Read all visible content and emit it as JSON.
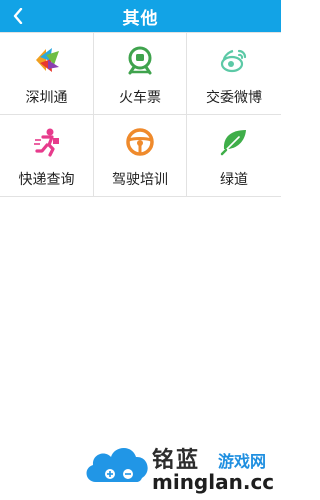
{
  "header": {
    "title": "其他",
    "back_icon": "chevron-left-icon"
  },
  "colors": {
    "accent": "#12a3e6"
  },
  "grid": [
    {
      "label": "深圳通",
      "icon": "shenzhentong-icon"
    },
    {
      "label": "火车票",
      "icon": "train-icon"
    },
    {
      "label": "交委微博",
      "icon": "weibo-icon"
    },
    {
      "label": "快递查询",
      "icon": "courier-runner-icon"
    },
    {
      "label": "驾驶培训",
      "icon": "steering-wheel-icon"
    },
    {
      "label": "绿道",
      "icon": "leaf-icon"
    }
  ],
  "watermark": {
    "brand": "铭蓝",
    "tag": "游戏网",
    "url": "minglan.cc"
  }
}
